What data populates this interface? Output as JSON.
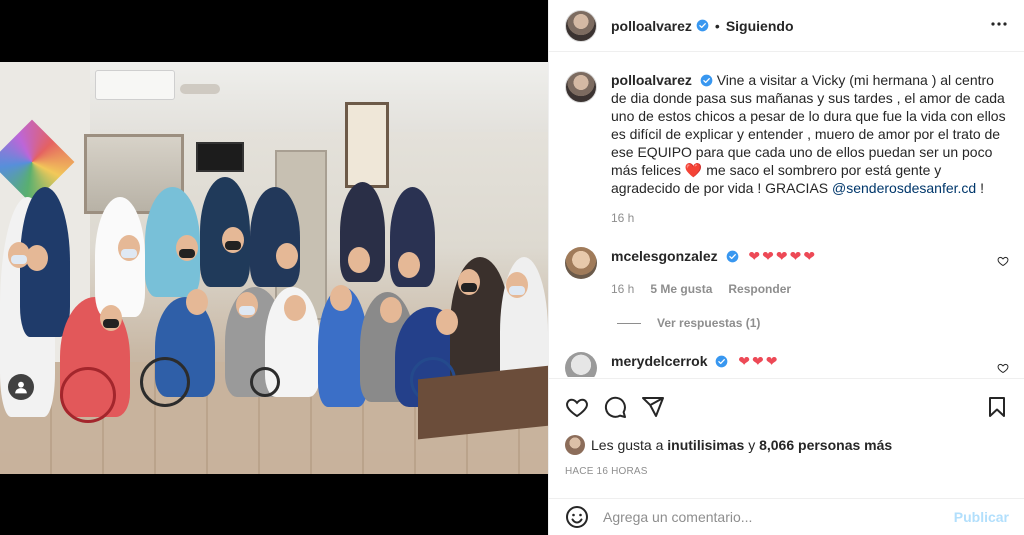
{
  "post": {
    "username": "polloalvarez",
    "separator": "•",
    "follow_status": "Siguiendo",
    "caption_text": "Vine a visitar a Vicky (mi hermana ) al centro de dia donde pasa sus mañanas y sus tardes , el amor de cada uno de estos chicos a pesar de lo dura que fue la vida con ellos es difícil de explicar y entender , muero de amor por el trato de ese EQUIPO para que cada uno de ellos puedan ser un poco más felices",
    "caption_heart": "❤️",
    "caption_text_2": "me saco el sombrero por está gente y agradecido de por vida ! GRACIAS",
    "caption_mention": "@senderosdesanfer.cd",
    "caption_end": "!",
    "caption_time": "16 h"
  },
  "comments": [
    {
      "username": "mcelesgonzalez",
      "text": "❤❤❤❤❤",
      "time": "16 h",
      "likes": "5 Me gusta",
      "reply": "Responder",
      "view_replies": "Ver respuestas (1)"
    },
    {
      "username": "merydelcerrok",
      "text": "❤❤❤"
    }
  ],
  "likes_summary": {
    "prefix": "Les gusta a",
    "user": "inutilisimas",
    "connector": "y",
    "others": "8,066 personas más"
  },
  "posted_ago": "HACE 16 HORAS",
  "add_comment": {
    "placeholder": "Agrega un comentario...",
    "publish": "Publicar"
  },
  "colors": {
    "verified": "#3897f0",
    "heart": "#ed4956",
    "link": "#00376b",
    "publish_disabled": "#b2dffc"
  }
}
